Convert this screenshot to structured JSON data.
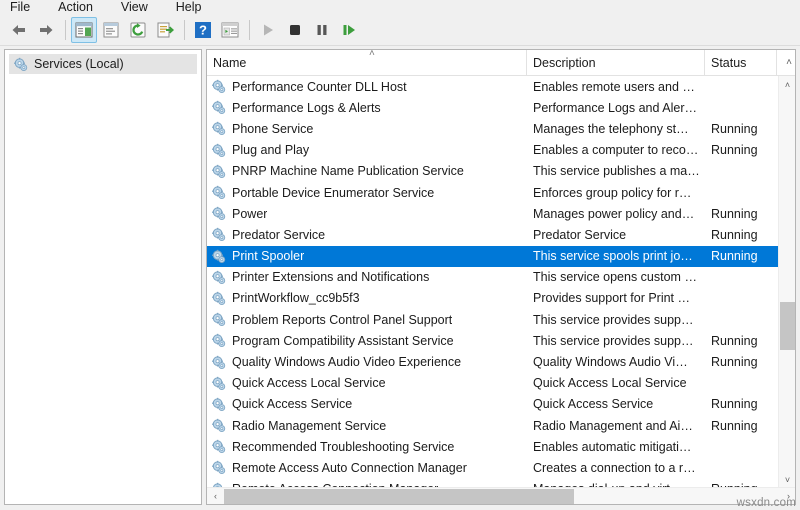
{
  "menubar": {
    "items": [
      {
        "label": "File",
        "name": "menu-file"
      },
      {
        "label": "Action",
        "name": "menu-action"
      },
      {
        "label": "View",
        "name": "menu-view"
      },
      {
        "label": "Help",
        "name": "menu-help"
      }
    ]
  },
  "toolbar": {
    "buttons": [
      {
        "icon": "back-arrow-icon",
        "label": "Back"
      },
      {
        "icon": "forward-arrow-icon",
        "label": "Forward"
      },
      {
        "icon": "show-hide-tree-icon",
        "label": "Show/Hide Console Tree"
      },
      {
        "icon": "properties-icon",
        "label": "Properties"
      },
      {
        "icon": "refresh-icon",
        "label": "Refresh"
      },
      {
        "icon": "export-list-icon",
        "label": "Export List"
      },
      {
        "icon": "help-icon",
        "label": "Help"
      },
      {
        "icon": "console-view-icon",
        "label": "Show/Hide Action Pane"
      },
      {
        "icon": "start-service-icon",
        "label": "Start Service"
      },
      {
        "icon": "stop-service-icon",
        "label": "Stop Service"
      },
      {
        "icon": "pause-service-icon",
        "label": "Pause Service"
      },
      {
        "icon": "restart-service-icon",
        "label": "Restart Service"
      }
    ]
  },
  "tree": {
    "root": {
      "label": "Services (Local)",
      "icon": "services-gear-icon",
      "selected": true
    }
  },
  "list": {
    "columns": [
      {
        "label": "Name"
      },
      {
        "label": "Description"
      },
      {
        "label": "Status"
      }
    ],
    "sort_indicator": "˄",
    "header_caret": "˄",
    "rows": [
      {
        "name": "Performance Counter DLL Host",
        "description": "Enables remote users and …",
        "status": ""
      },
      {
        "name": "Performance Logs & Alerts",
        "description": "Performance Logs and Aler…",
        "status": ""
      },
      {
        "name": "Phone Service",
        "description": "Manages the telephony st…",
        "status": "Running"
      },
      {
        "name": "Plug and Play",
        "description": "Enables a computer to reco…",
        "status": "Running"
      },
      {
        "name": "PNRP Machine Name Publication Service",
        "description": "This service publishes a ma…",
        "status": ""
      },
      {
        "name": "Portable Device Enumerator Service",
        "description": "Enforces group policy for r…",
        "status": ""
      },
      {
        "name": "Power",
        "description": "Manages power policy and…",
        "status": "Running"
      },
      {
        "name": "Predator Service",
        "description": "Predator Service",
        "status": "Running"
      },
      {
        "name": "Print Spooler",
        "description": "This service spools print jo…",
        "status": "Running",
        "selected": true
      },
      {
        "name": "Printer Extensions and Notifications",
        "description": "This service opens custom …",
        "status": ""
      },
      {
        "name": "PrintWorkflow_cc9b5f3",
        "description": "Provides support for Print …",
        "status": ""
      },
      {
        "name": "Problem Reports Control Panel Support",
        "description": "This service provides supp…",
        "status": ""
      },
      {
        "name": "Program Compatibility Assistant Service",
        "description": "This service provides supp…",
        "status": "Running"
      },
      {
        "name": "Quality Windows Audio Video Experience",
        "description": "Quality Windows Audio Vi…",
        "status": "Running"
      },
      {
        "name": "Quick Access Local Service",
        "description": "Quick Access Local Service",
        "status": ""
      },
      {
        "name": "Quick Access Service",
        "description": "Quick Access Service",
        "status": "Running"
      },
      {
        "name": "Radio Management Service",
        "description": "Radio Management and Ai…",
        "status": "Running"
      },
      {
        "name": "Recommended Troubleshooting Service",
        "description": "Enables automatic mitigati…",
        "status": ""
      },
      {
        "name": "Remote Access Auto Connection Manager",
        "description": "Creates a connection to a r…",
        "status": ""
      },
      {
        "name": "Remote Access Connection Manager",
        "description": "Manages dial-up and virt…",
        "status": "Running"
      }
    ]
  },
  "scrollbars": {
    "vertical": {
      "up_arrow": "˄",
      "down_arrow": "˅"
    },
    "horizontal": {
      "left_arrow": "‹",
      "right_arrow": "›"
    }
  },
  "watermark": {
    "text": "wsxdn.com"
  },
  "colors": {
    "selection": "#0078d7",
    "toolbar_active": "#cde8f7",
    "gear_icon": "#a8c8e0",
    "pane_border": "#b4b4b4"
  }
}
